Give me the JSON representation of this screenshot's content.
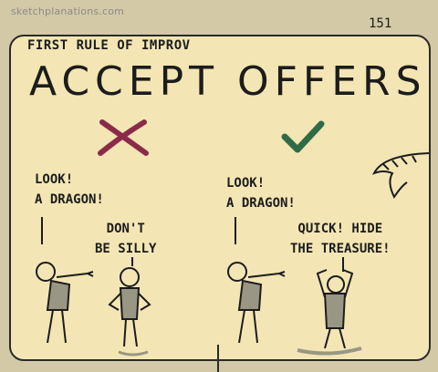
{
  "credit": "sketchplanations.com",
  "page_number": "151",
  "subtitle": "FIRST RULE OF iMPROV",
  "title": "ACCEPT OFFERS",
  "left_panel": {
    "speaker_lines": [
      "LOOK!",
      "A DRAGON!"
    ],
    "listener_lines": [
      "DON'T",
      "BE SiLLY"
    ]
  },
  "right_panel": {
    "speaker_lines": [
      "LOOK!",
      "A DRAGON!"
    ],
    "listener_lines": [
      "QUiCK! HiDE",
      "THE TREASURE!"
    ]
  },
  "icons": {
    "reject": "cross-icon",
    "accept": "check-icon"
  },
  "colors": {
    "background": "#f3e6b4",
    "border": "#d3c9a6",
    "cross": "#8c2a4a",
    "check": "#2f6b47",
    "figure_shadow": "#9a9684"
  }
}
